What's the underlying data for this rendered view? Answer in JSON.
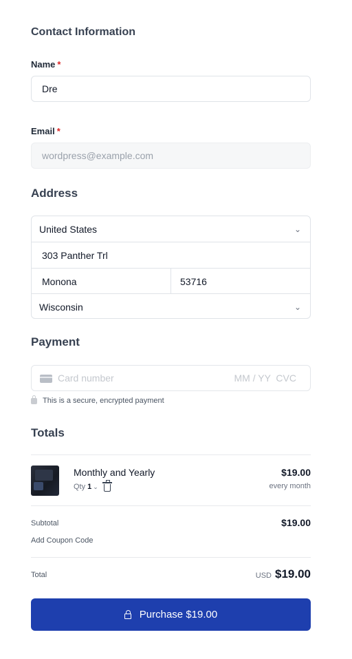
{
  "contact": {
    "heading": "Contact Information",
    "name_label": "Name",
    "name_value": "Dre",
    "email_label": "Email",
    "email_value": "wordpress@example.com",
    "required_mark": "*"
  },
  "address": {
    "heading": "Address",
    "country": "United States",
    "street": "303 Panther Trl",
    "city": "Monona",
    "zip": "53716",
    "state": "Wisconsin"
  },
  "payment": {
    "heading": "Payment",
    "card_placeholder": "Card number",
    "expiry_cvc_placeholder": "MM / YY  CVC",
    "secure_note": "This is a secure, encrypted payment"
  },
  "totals": {
    "heading": "Totals",
    "item": {
      "name": "Monthly and Yearly",
      "qty_label": "Qty",
      "qty_value": "1",
      "price": "$19.00",
      "interval": "every month"
    },
    "subtotal_label": "Subtotal",
    "subtotal_value": "$19.00",
    "coupon_link": "Add Coupon Code",
    "total_label": "Total",
    "currency": "USD",
    "total_value": "$19.00"
  },
  "purchase_button": "Purchase $19.00",
  "colors": {
    "primary": "#1e3fae",
    "required": "#dc2626",
    "border": "#dfe3e8"
  }
}
